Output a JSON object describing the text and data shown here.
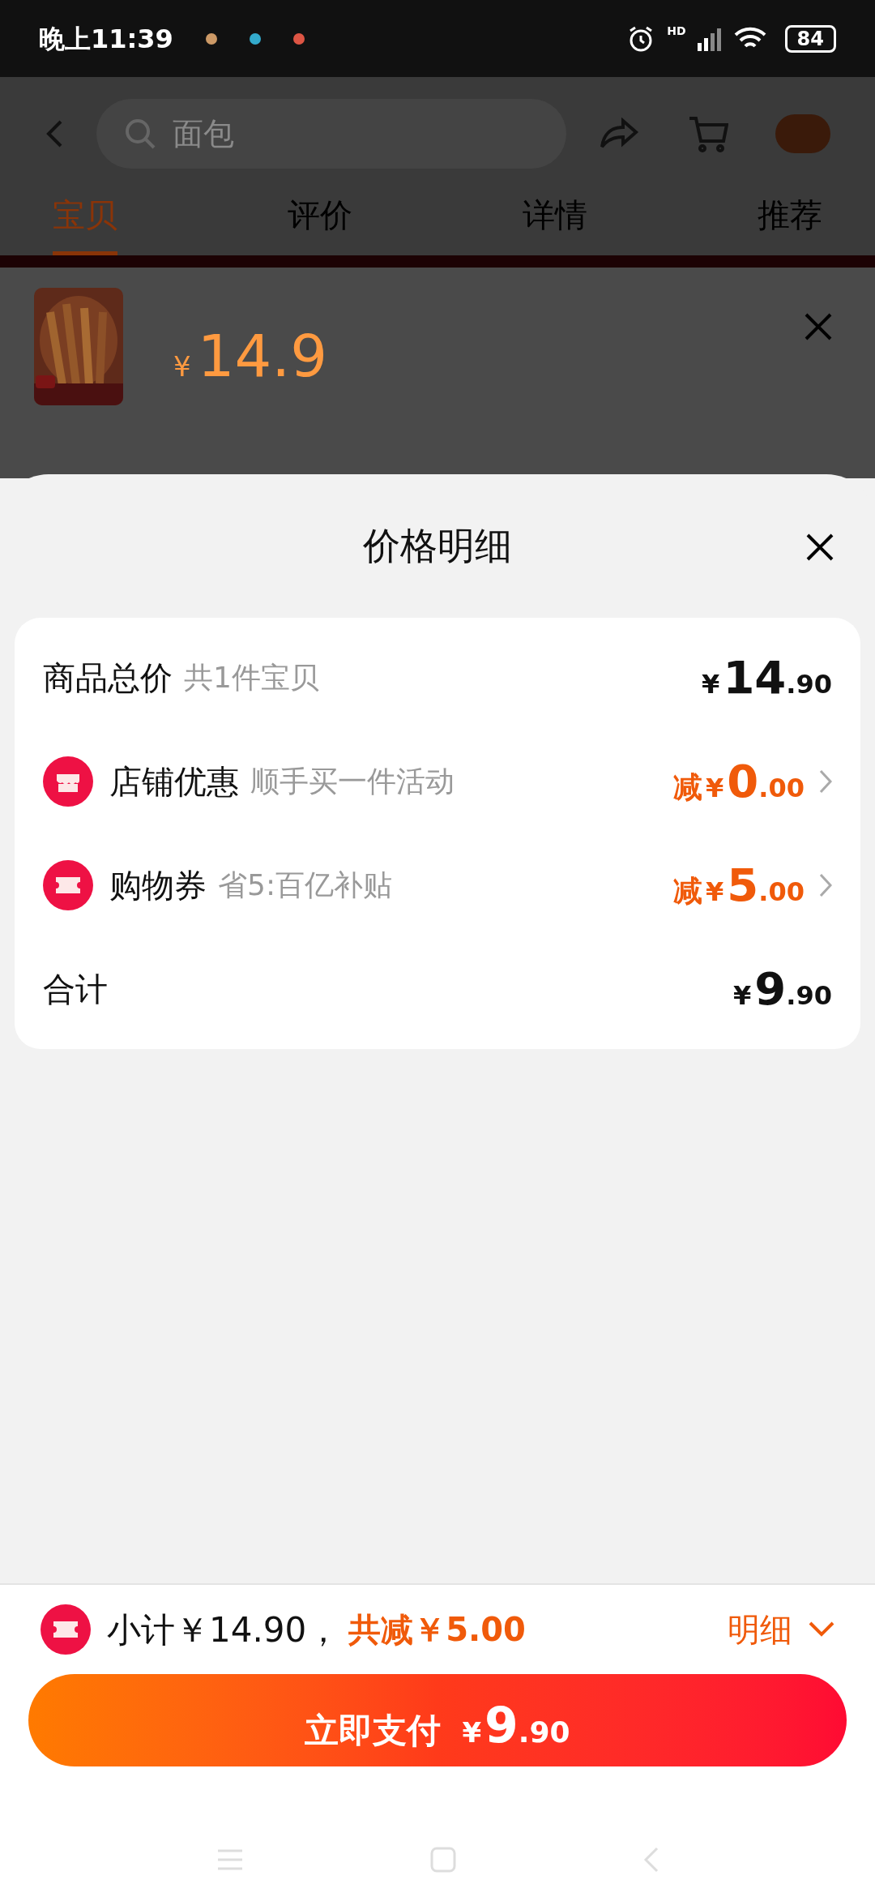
{
  "status_bar": {
    "time": "晚上11:39",
    "battery": "84",
    "network": "HD"
  },
  "header": {
    "search": {
      "placeholder": "面包"
    }
  },
  "tabs": [
    {
      "label": "宝贝",
      "selected": true
    },
    {
      "label": "评价",
      "selected": false
    },
    {
      "label": "详情",
      "selected": false
    },
    {
      "label": "推荐",
      "selected": false
    }
  ],
  "product": {
    "kind": "picture",
    "price_symbol": "¥",
    "price": "14.9"
  },
  "sheet": {
    "title": "价格明细",
    "rows": [
      {
        "kind": "plain",
        "label": "商品总价",
        "note": "共1件宝贝",
        "prefix": "",
        "symbol": "¥",
        "int": "14",
        "dec": ".90",
        "highlight": false
      },
      {
        "kind": "shop",
        "label": "店铺优惠",
        "note": "顺手买一件活动",
        "prefix": "减",
        "symbol": "¥",
        "int": "0",
        "dec": ".00",
        "highlight": true
      },
      {
        "kind": "coupon",
        "label": "购物券",
        "note": "省5:百亿补贴",
        "prefix": "减",
        "symbol": "¥",
        "int": "5",
        "dec": ".00",
        "highlight": true
      },
      {
        "kind": "plain",
        "label": "合计",
        "note": "",
        "prefix": "",
        "symbol": "¥",
        "int": "9",
        "dec": ".90",
        "highlight": false
      }
    ]
  },
  "footer": {
    "subtotal": "小计￥14.90，",
    "discount": "共减￥5.00",
    "details": "明细",
    "expanded": false,
    "pay": {
      "label": "立即支付",
      "symbol": "¥",
      "int": "9",
      "dec": ".90"
    }
  }
}
